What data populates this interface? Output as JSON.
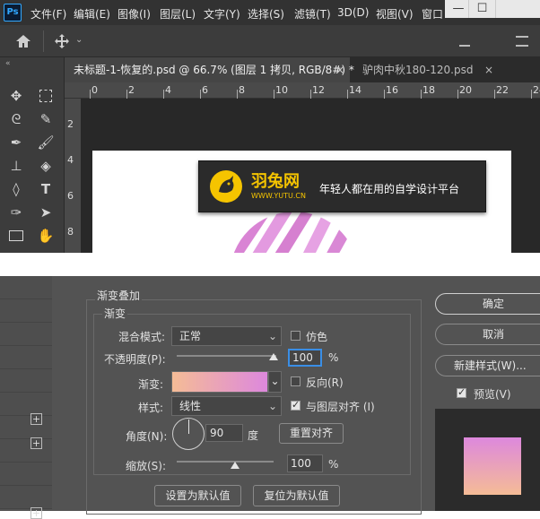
{
  "menubar": {
    "logo": "Ps",
    "items": [
      "文件(F)",
      "编辑(E)",
      "图像(I)",
      "图层(L)",
      "文字(Y)",
      "选择(S)",
      "滤镜(T)",
      "3D(D)",
      "视图(V)",
      "窗口"
    ],
    "window_buttons": [
      "—",
      "☐"
    ]
  },
  "tabs": [
    {
      "label": "未标题-1-恢复的.psd @ 66.7% (图层 1 拷贝, RGB/8#) *",
      "close": "×"
    },
    {
      "label": "驴肉中秋180-120.psd",
      "close": "×"
    }
  ],
  "ruler": {
    "h_ticks": [
      "0",
      "2",
      "4",
      "6",
      "8",
      "10",
      "12",
      "14",
      "16",
      "18",
      "20",
      "22",
      "24"
    ],
    "v_ticks": [
      "2",
      "4",
      "6",
      "8"
    ]
  },
  "watermark": {
    "brand": "羽兔网",
    "url": "WWW.YUTU.CN",
    "slogan": "年轻人都在用的自学设计平台"
  },
  "dialog": {
    "section_title": "渐变叠加",
    "group_title": "渐变",
    "blend_mode_label": "混合模式:",
    "blend_mode_value": "正常",
    "dither_label": "仿色",
    "opacity_label": "不透明度(P):",
    "opacity_value": "100",
    "opacity_unit": "%",
    "opacity_level": 1.0,
    "gradient_label": "渐变:",
    "reverse_label": "反向(R)",
    "style_label": "样式:",
    "style_value": "线性",
    "align_label": "与图层对齐 (I)",
    "angle_label": "角度(N):",
    "angle_value": "90",
    "angle_unit": "度",
    "reset_align_button": "重置对齐",
    "scale_label": "缩放(S):",
    "scale_value": "100",
    "scale_unit": "%",
    "scale_level": 0.6,
    "set_default_button": "设置为默认值",
    "reset_default_button": "复位为默认值",
    "ok_button": "确定",
    "cancel_button": "取消",
    "new_style_button": "新建样式(W)...",
    "preview_label": "预览(V)",
    "colors": {
      "gradient_start": "#f5bc96",
      "gradient_end": "#dd88dd"
    }
  }
}
